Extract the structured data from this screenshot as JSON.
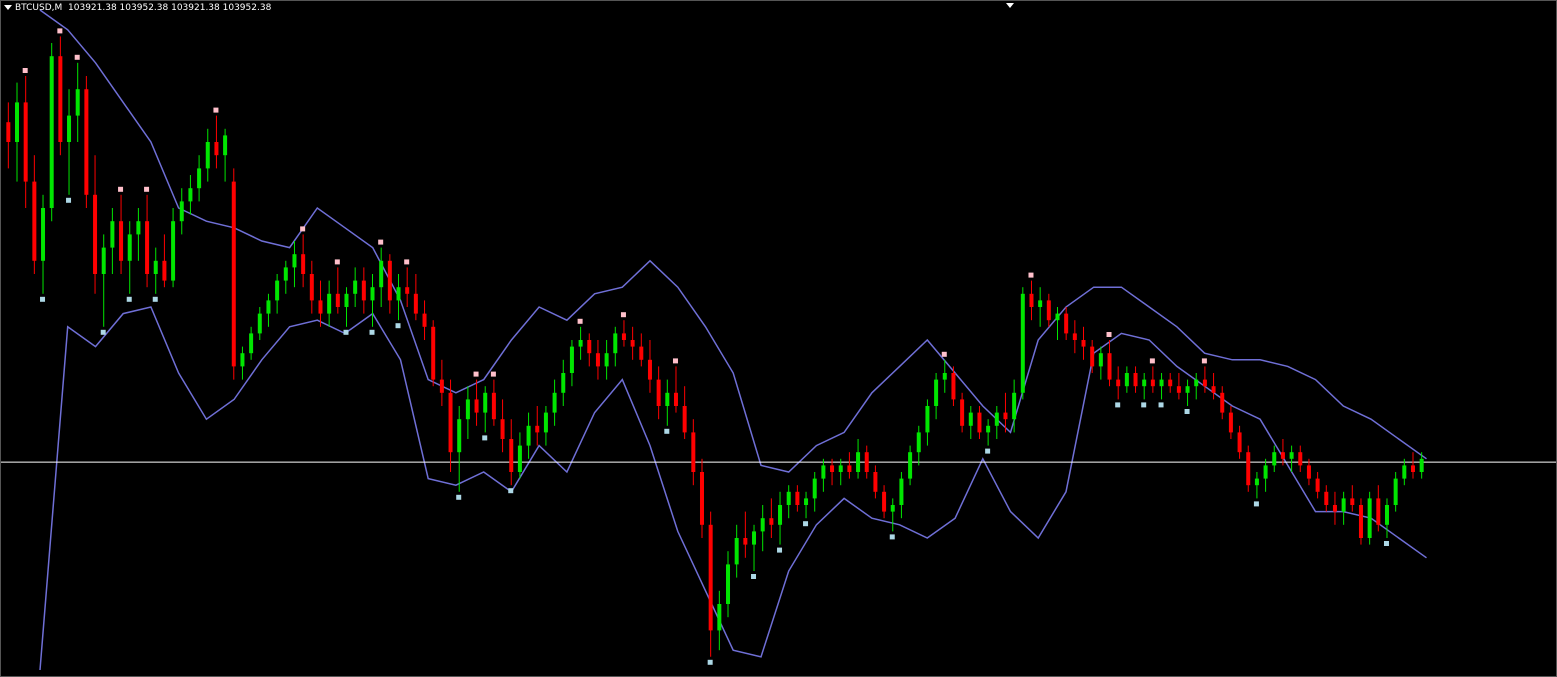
{
  "header": {
    "symbol": "BTCUSD,M",
    "ohlc": "103921.38 103952.38 103921.38 103952.38"
  },
  "colors": {
    "background": "#000000",
    "bull": "#00e600",
    "bear": "#ff0000",
    "band": "#6f6fd6",
    "price_line": "#ffffff",
    "marker_high": "#ffc0cb",
    "marker_low": "#add8e6"
  },
  "chart_data": {
    "type": "candlestick",
    "symbol": "BTCUSD,M",
    "y_range_pixels_note": "",
    "current_price_level": 0.315,
    "candles": [
      [
        0.83,
        0.86,
        0.76,
        0.8
      ],
      [
        0.8,
        0.89,
        0.74,
        0.86
      ],
      [
        0.86,
        0.9,
        0.7,
        0.74
      ],
      [
        0.74,
        0.78,
        0.6,
        0.62
      ],
      [
        0.62,
        0.72,
        0.57,
        0.7
      ],
      [
        0.7,
        0.95,
        0.68,
        0.93
      ],
      [
        0.93,
        0.96,
        0.78,
        0.8
      ],
      [
        0.8,
        0.88,
        0.72,
        0.84
      ],
      [
        0.84,
        0.92,
        0.8,
        0.88
      ],
      [
        0.88,
        0.9,
        0.7,
        0.72
      ],
      [
        0.72,
        0.78,
        0.57,
        0.6
      ],
      [
        0.6,
        0.66,
        0.52,
        0.64
      ],
      [
        0.64,
        0.7,
        0.6,
        0.68
      ],
      [
        0.68,
        0.72,
        0.6,
        0.62
      ],
      [
        0.62,
        0.68,
        0.57,
        0.66
      ],
      [
        0.66,
        0.7,
        0.62,
        0.68
      ],
      [
        0.68,
        0.72,
        0.58,
        0.6
      ],
      [
        0.6,
        0.64,
        0.57,
        0.62
      ],
      [
        0.62,
        0.66,
        0.58,
        0.59
      ],
      [
        0.59,
        0.7,
        0.58,
        0.68
      ],
      [
        0.68,
        0.73,
        0.66,
        0.71
      ],
      [
        0.71,
        0.75,
        0.69,
        0.73
      ],
      [
        0.73,
        0.78,
        0.71,
        0.76
      ],
      [
        0.76,
        0.82,
        0.74,
        0.8
      ],
      [
        0.8,
        0.84,
        0.76,
        0.78
      ],
      [
        0.78,
        0.82,
        0.74,
        0.81
      ],
      [
        0.74,
        0.76,
        0.44,
        0.46
      ],
      [
        0.46,
        0.49,
        0.44,
        0.48
      ],
      [
        0.48,
        0.52,
        0.47,
        0.51
      ],
      [
        0.51,
        0.55,
        0.5,
        0.54
      ],
      [
        0.54,
        0.57,
        0.52,
        0.56
      ],
      [
        0.56,
        0.6,
        0.54,
        0.59
      ],
      [
        0.59,
        0.62,
        0.57,
        0.61
      ],
      [
        0.61,
        0.65,
        0.58,
        0.63
      ],
      [
        0.63,
        0.66,
        0.58,
        0.6
      ],
      [
        0.6,
        0.62,
        0.54,
        0.56
      ],
      [
        0.56,
        0.59,
        0.52,
        0.54
      ],
      [
        0.54,
        0.59,
        0.52,
        0.57
      ],
      [
        0.57,
        0.61,
        0.54,
        0.55
      ],
      [
        0.55,
        0.58,
        0.52,
        0.57
      ],
      [
        0.57,
        0.61,
        0.55,
        0.59
      ],
      [
        0.59,
        0.61,
        0.54,
        0.56
      ],
      [
        0.56,
        0.6,
        0.52,
        0.58
      ],
      [
        0.58,
        0.64,
        0.55,
        0.62
      ],
      [
        0.62,
        0.63,
        0.54,
        0.56
      ],
      [
        0.56,
        0.6,
        0.53,
        0.58
      ],
      [
        0.58,
        0.61,
        0.55,
        0.57
      ],
      [
        0.57,
        0.6,
        0.53,
        0.54
      ],
      [
        0.54,
        0.56,
        0.5,
        0.52
      ],
      [
        0.52,
        0.53,
        0.43,
        0.44
      ],
      [
        0.44,
        0.47,
        0.4,
        0.42
      ],
      [
        0.42,
        0.44,
        0.3,
        0.33
      ],
      [
        0.33,
        0.4,
        0.27,
        0.38
      ],
      [
        0.38,
        0.43,
        0.35,
        0.41
      ],
      [
        0.41,
        0.44,
        0.37,
        0.39
      ],
      [
        0.39,
        0.43,
        0.36,
        0.42
      ],
      [
        0.42,
        0.44,
        0.37,
        0.38
      ],
      [
        0.38,
        0.41,
        0.33,
        0.35
      ],
      [
        0.35,
        0.38,
        0.28,
        0.3
      ],
      [
        0.3,
        0.36,
        0.29,
        0.34
      ],
      [
        0.34,
        0.39,
        0.32,
        0.37
      ],
      [
        0.37,
        0.4,
        0.34,
        0.36
      ],
      [
        0.36,
        0.4,
        0.34,
        0.39
      ],
      [
        0.39,
        0.44,
        0.37,
        0.42
      ],
      [
        0.42,
        0.47,
        0.4,
        0.45
      ],
      [
        0.45,
        0.5,
        0.43,
        0.49
      ],
      [
        0.49,
        0.52,
        0.47,
        0.5
      ],
      [
        0.5,
        0.51,
        0.46,
        0.48
      ],
      [
        0.48,
        0.5,
        0.44,
        0.46
      ],
      [
        0.46,
        0.5,
        0.44,
        0.48
      ],
      [
        0.48,
        0.52,
        0.46,
        0.51
      ],
      [
        0.51,
        0.53,
        0.49,
        0.5
      ],
      [
        0.5,
        0.52,
        0.47,
        0.49
      ],
      [
        0.49,
        0.51,
        0.46,
        0.47
      ],
      [
        0.47,
        0.5,
        0.42,
        0.44
      ],
      [
        0.44,
        0.46,
        0.38,
        0.4
      ],
      [
        0.4,
        0.44,
        0.37,
        0.42
      ],
      [
        0.42,
        0.46,
        0.39,
        0.4
      ],
      [
        0.4,
        0.43,
        0.35,
        0.36
      ],
      [
        0.36,
        0.38,
        0.28,
        0.3
      ],
      [
        0.3,
        0.32,
        0.2,
        0.22
      ],
      [
        0.22,
        0.24,
        0.02,
        0.06
      ],
      [
        0.06,
        0.12,
        0.03,
        0.1
      ],
      [
        0.1,
        0.18,
        0.08,
        0.16
      ],
      [
        0.16,
        0.22,
        0.14,
        0.2
      ],
      [
        0.2,
        0.24,
        0.17,
        0.19
      ],
      [
        0.19,
        0.22,
        0.15,
        0.21
      ],
      [
        0.21,
        0.25,
        0.18,
        0.23
      ],
      [
        0.23,
        0.26,
        0.2,
        0.22
      ],
      [
        0.22,
        0.27,
        0.19,
        0.25
      ],
      [
        0.25,
        0.28,
        0.23,
        0.27
      ],
      [
        0.27,
        0.28,
        0.24,
        0.25
      ],
      [
        0.25,
        0.27,
        0.23,
        0.26
      ],
      [
        0.26,
        0.3,
        0.24,
        0.29
      ],
      [
        0.29,
        0.32,
        0.27,
        0.31
      ],
      [
        0.31,
        0.32,
        0.28,
        0.3
      ],
      [
        0.3,
        0.32,
        0.28,
        0.31
      ],
      [
        0.31,
        0.33,
        0.29,
        0.3
      ],
      [
        0.3,
        0.35,
        0.29,
        0.33
      ],
      [
        0.33,
        0.34,
        0.29,
        0.3
      ],
      [
        0.3,
        0.31,
        0.26,
        0.27
      ],
      [
        0.27,
        0.28,
        0.23,
        0.24
      ],
      [
        0.24,
        0.26,
        0.21,
        0.25
      ],
      [
        0.25,
        0.3,
        0.23,
        0.29
      ],
      [
        0.29,
        0.34,
        0.28,
        0.33
      ],
      [
        0.33,
        0.37,
        0.31,
        0.36
      ],
      [
        0.36,
        0.41,
        0.34,
        0.4
      ],
      [
        0.4,
        0.45,
        0.38,
        0.44
      ],
      [
        0.44,
        0.47,
        0.42,
        0.45
      ],
      [
        0.45,
        0.46,
        0.4,
        0.41
      ],
      [
        0.41,
        0.42,
        0.36,
        0.37
      ],
      [
        0.37,
        0.4,
        0.35,
        0.39
      ],
      [
        0.39,
        0.4,
        0.35,
        0.36
      ],
      [
        0.36,
        0.38,
        0.34,
        0.37
      ],
      [
        0.37,
        0.4,
        0.35,
        0.39
      ],
      [
        0.39,
        0.42,
        0.36,
        0.38
      ],
      [
        0.38,
        0.44,
        0.36,
        0.42
      ],
      [
        0.42,
        0.58,
        0.41,
        0.57
      ],
      [
        0.57,
        0.59,
        0.53,
        0.55
      ],
      [
        0.55,
        0.58,
        0.52,
        0.56
      ],
      [
        0.56,
        0.57,
        0.52,
        0.53
      ],
      [
        0.53,
        0.55,
        0.5,
        0.54
      ],
      [
        0.54,
        0.55,
        0.5,
        0.51
      ],
      [
        0.51,
        0.53,
        0.48,
        0.5
      ],
      [
        0.5,
        0.52,
        0.47,
        0.49
      ],
      [
        0.49,
        0.5,
        0.45,
        0.46
      ],
      [
        0.46,
        0.49,
        0.44,
        0.48
      ],
      [
        0.48,
        0.5,
        0.43,
        0.44
      ],
      [
        0.44,
        0.46,
        0.41,
        0.43
      ],
      [
        0.43,
        0.46,
        0.42,
        0.45
      ],
      [
        0.45,
        0.46,
        0.42,
        0.43
      ],
      [
        0.43,
        0.45,
        0.41,
        0.44
      ],
      [
        0.44,
        0.46,
        0.42,
        0.43
      ],
      [
        0.43,
        0.45,
        0.41,
        0.44
      ],
      [
        0.44,
        0.45,
        0.42,
        0.43
      ],
      [
        0.43,
        0.45,
        0.41,
        0.42
      ],
      [
        0.42,
        0.44,
        0.4,
        0.43
      ],
      [
        0.43,
        0.45,
        0.41,
        0.44
      ],
      [
        0.44,
        0.46,
        0.42,
        0.43
      ],
      [
        0.43,
        0.45,
        0.41,
        0.42
      ],
      [
        0.42,
        0.43,
        0.38,
        0.39
      ],
      [
        0.39,
        0.4,
        0.35,
        0.36
      ],
      [
        0.36,
        0.37,
        0.32,
        0.33
      ],
      [
        0.33,
        0.34,
        0.27,
        0.28
      ],
      [
        0.28,
        0.3,
        0.26,
        0.29
      ],
      [
        0.29,
        0.32,
        0.27,
        0.31
      ],
      [
        0.31,
        0.34,
        0.3,
        0.33
      ],
      [
        0.33,
        0.35,
        0.31,
        0.32
      ],
      [
        0.32,
        0.34,
        0.3,
        0.33
      ],
      [
        0.33,
        0.34,
        0.3,
        0.31
      ],
      [
        0.31,
        0.32,
        0.28,
        0.29
      ],
      [
        0.29,
        0.3,
        0.26,
        0.27
      ],
      [
        0.27,
        0.28,
        0.24,
        0.25
      ],
      [
        0.25,
        0.27,
        0.22,
        0.24
      ],
      [
        0.24,
        0.27,
        0.22,
        0.26
      ],
      [
        0.26,
        0.28,
        0.24,
        0.25
      ],
      [
        0.25,
        0.26,
        0.19,
        0.2
      ],
      [
        0.2,
        0.27,
        0.19,
        0.26
      ],
      [
        0.26,
        0.28,
        0.21,
        0.22
      ],
      [
        0.22,
        0.26,
        0.2,
        0.25
      ],
      [
        0.25,
        0.3,
        0.24,
        0.29
      ],
      [
        0.29,
        0.32,
        0.28,
        0.31
      ],
      [
        0.31,
        0.33,
        0.29,
        0.3
      ],
      [
        0.3,
        0.33,
        0.29,
        0.32
      ]
    ],
    "upper_band": [
      1.0,
      0.97,
      0.92,
      0.86,
      0.8,
      0.7,
      0.68,
      0.67,
      0.65,
      0.64,
      0.7,
      0.67,
      0.64,
      0.56,
      0.44,
      0.42,
      0.44,
      0.5,
      0.55,
      0.53,
      0.57,
      0.58,
      0.62,
      0.58,
      0.52,
      0.45,
      0.31,
      0.3,
      0.34,
      0.36,
      0.42,
      0.46,
      0.5,
      0.45,
      0.4,
      0.36,
      0.5,
      0.55,
      0.58,
      0.58,
      0.55,
      0.52,
      0.48,
      0.47,
      0.47,
      0.46,
      0.44,
      0.4,
      0.38,
      0.35,
      0.32
    ],
    "lower_band": [
      0.0,
      0.52,
      0.49,
      0.54,
      0.55,
      0.45,
      0.38,
      0.41,
      0.47,
      0.52,
      0.53,
      0.51,
      0.54,
      0.47,
      0.29,
      0.28,
      0.3,
      0.27,
      0.34,
      0.3,
      0.39,
      0.44,
      0.34,
      0.21,
      0.12,
      0.03,
      0.02,
      0.15,
      0.22,
      0.26,
      0.23,
      0.22,
      0.2,
      0.23,
      0.32,
      0.24,
      0.2,
      0.27,
      0.48,
      0.51,
      0.5,
      0.46,
      0.43,
      0.4,
      0.38,
      0.31,
      0.24,
      0.24,
      0.23,
      0.2,
      0.17
    ]
  }
}
